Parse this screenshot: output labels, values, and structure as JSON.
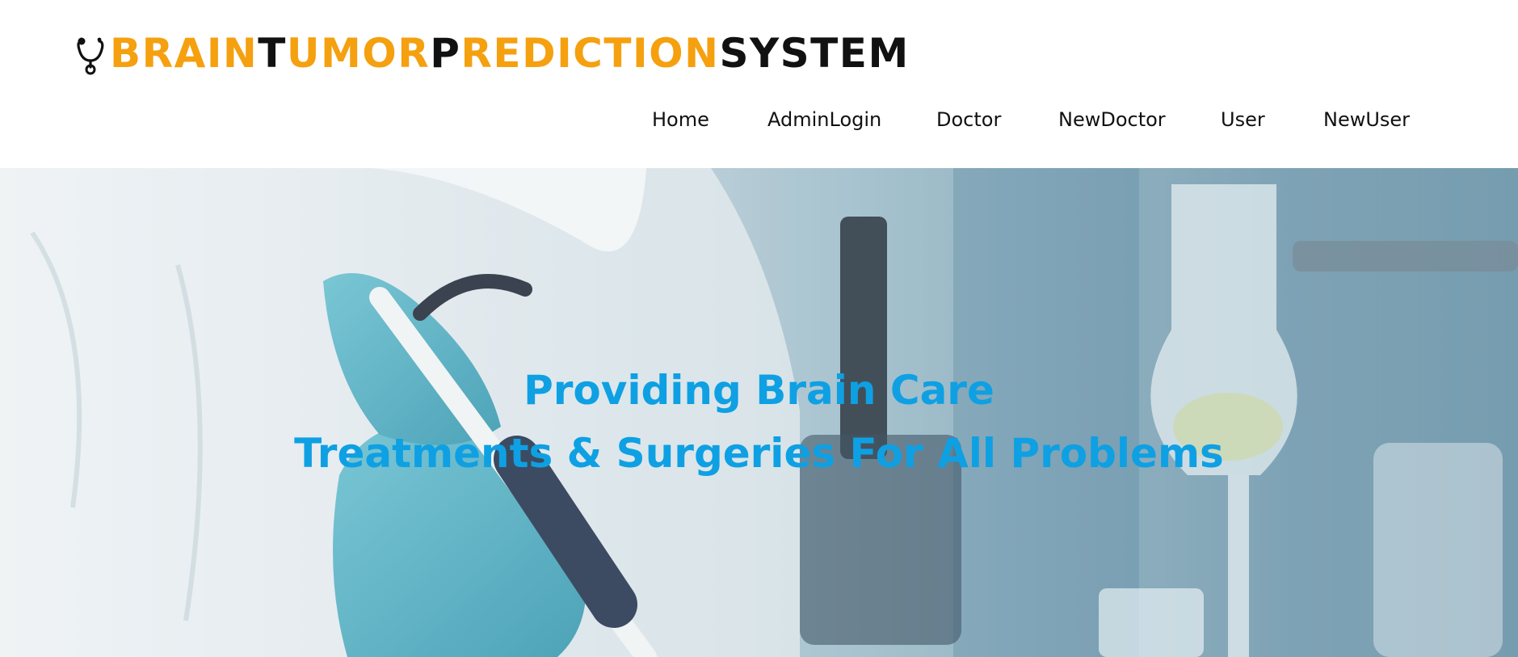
{
  "brand": {
    "icon": "stethoscope-icon",
    "parts": [
      {
        "text": "B",
        "color": "#f5a00f"
      },
      {
        "text": "RAIN",
        "color": "#f5a00f"
      },
      {
        "text": "T",
        "color": "#111111"
      },
      {
        "text": "UMOR",
        "color": "#f5a00f"
      },
      {
        "text": "P",
        "color": "#111111"
      },
      {
        "text": "REDICTION",
        "color": "#f5a00f"
      },
      {
        "text": "SYSTEM",
        "color": "#111111"
      }
    ]
  },
  "nav": {
    "items": [
      "Home",
      "AdminLogin",
      "Doctor",
      "NewDoctor",
      "User",
      "NewUser"
    ]
  },
  "hero": {
    "line1": "Providing Brain Care",
    "line2": "Treatments & Surgeries For All Problems",
    "text_color": "#0ea0e3"
  },
  "colors": {
    "accent": "#f5a00f",
    "dark": "#111111",
    "hero_text": "#0ea0e3"
  }
}
